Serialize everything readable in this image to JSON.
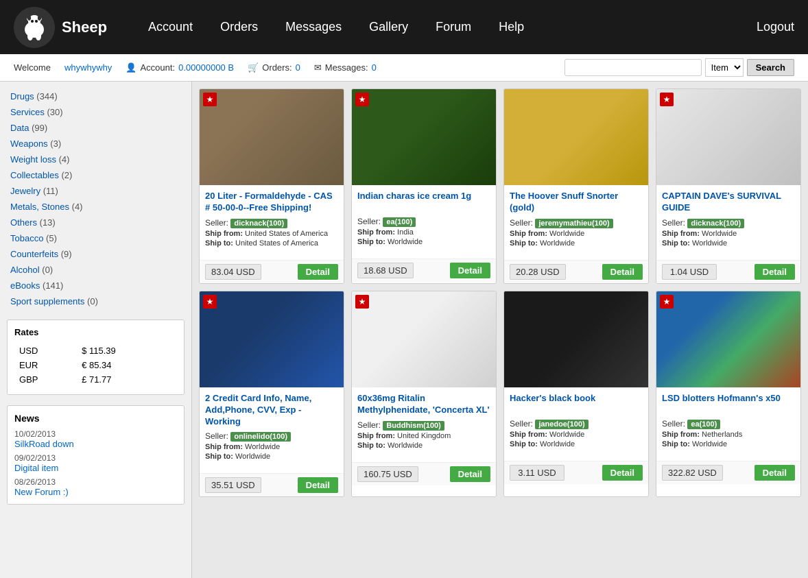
{
  "header": {
    "logo_text": "Sheep",
    "nav_items": [
      "Account",
      "Orders",
      "Messages",
      "Gallery",
      "Forum",
      "Help"
    ],
    "logout_label": "Logout"
  },
  "subheader": {
    "welcome_prefix": "Welcome",
    "username": "whywhywhy",
    "account_label": "Account:",
    "account_value": "0.00000000 B",
    "orders_label": "Orders:",
    "orders_value": "0",
    "messages_label": "Messages:",
    "messages_value": "0",
    "search_placeholder": "",
    "search_dropdown_label": "Item",
    "search_btn_label": "Search"
  },
  "sidebar": {
    "categories": [
      {
        "name": "Drugs",
        "count": "(344)"
      },
      {
        "name": "Services",
        "count": "(30)"
      },
      {
        "name": "Data",
        "count": "(99)"
      },
      {
        "name": "Weapons",
        "count": "(3)"
      },
      {
        "name": "Weight loss",
        "count": "(4)"
      },
      {
        "name": "Collectables",
        "count": "(2)"
      },
      {
        "name": "Jewelry",
        "count": "(11)"
      },
      {
        "name": "Metals, Stones",
        "count": "(4)"
      },
      {
        "name": "Others",
        "count": "(13)"
      },
      {
        "name": "Tobacco",
        "count": "(5)"
      },
      {
        "name": "Counterfeits",
        "count": "(9)"
      },
      {
        "name": "Alcohol",
        "count": "(0)"
      },
      {
        "name": "eBooks",
        "count": "(141)"
      },
      {
        "name": "Sport supplements",
        "count": "(0)"
      }
    ],
    "rates_title": "Rates",
    "rates": [
      {
        "currency": "USD",
        "symbol": "$",
        "value": "115.39"
      },
      {
        "currency": "EUR",
        "symbol": "€",
        "value": "85.34"
      },
      {
        "currency": "GBP",
        "symbol": "£",
        "value": "71.77"
      }
    ],
    "news_title": "News",
    "news_items": [
      {
        "date": "10/02/2013",
        "link": "SilkRoad down",
        "url": "#"
      },
      {
        "date": "09/02/2013",
        "link": "Digital item",
        "url": "#"
      },
      {
        "date": "08/26/2013",
        "link": "New Forum :)",
        "url": "#"
      }
    ]
  },
  "products": [
    {
      "featured": true,
      "title": "20 Liter - Formaldehyde - CAS # 50-00-0--Free Shipping!",
      "seller": "dicknack(100)",
      "ship_from": "United States of America",
      "ship_to": "United States of America",
      "price": "83.04 USD",
      "img_class": "img-formaldehyde"
    },
    {
      "featured": true,
      "title": "Indian charas ice cream 1g",
      "seller": "ea(100)",
      "ship_from": "India",
      "ship_to": "Worldwide",
      "price": "18.68 USD",
      "img_class": "img-charas"
    },
    {
      "featured": false,
      "title": "The Hoover Snuff Snorter (gold)",
      "seller": "jeremymathieu(100)",
      "ship_from": "Worldwide",
      "ship_to": "Worldwide",
      "price": "20.28 USD",
      "img_class": "img-snorter"
    },
    {
      "featured": true,
      "title": "CAPTAIN DAVE's SURVIVAL GUIDE",
      "seller": "dicknack(100)",
      "ship_from": "Worldwide",
      "ship_to": "Worldwide",
      "price": "1.04 USD",
      "img_class": "img-survival"
    },
    {
      "featured": true,
      "title": "2 Credit Card Info, Name, Add,Phone, CVV, Exp - Working",
      "seller": "onlinelido(100)",
      "ship_from": "Worldwide",
      "ship_to": "Worldwide",
      "price": "35.51 USD",
      "img_class": "img-creditcard"
    },
    {
      "featured": true,
      "title": "60x36mg Ritalin Methylphenidate, 'Concerta XL'",
      "seller": "Buddhism(100)",
      "ship_from": "United Kingdom",
      "ship_to": "Worldwide",
      "price": "160.75 USD",
      "img_class": "img-ritalin"
    },
    {
      "featured": false,
      "title": "Hacker's black book",
      "seller": "janedoe(100)",
      "ship_from": "Worldwide",
      "ship_to": "Worldwide",
      "price": "3.11 USD",
      "img_class": "img-hacker"
    },
    {
      "featured": true,
      "title": "LSD blotters Hofmann's x50",
      "seller": "ea(100)",
      "ship_from": "Netherlands",
      "ship_to": "Worldwide",
      "price": "322.82 USD",
      "img_class": "img-lsd"
    }
  ],
  "labels": {
    "seller": "Seller:",
    "ship_from": "Ship from:",
    "ship_to": "Ship to:",
    "detail_btn": "Detail",
    "featured_star": "★"
  }
}
